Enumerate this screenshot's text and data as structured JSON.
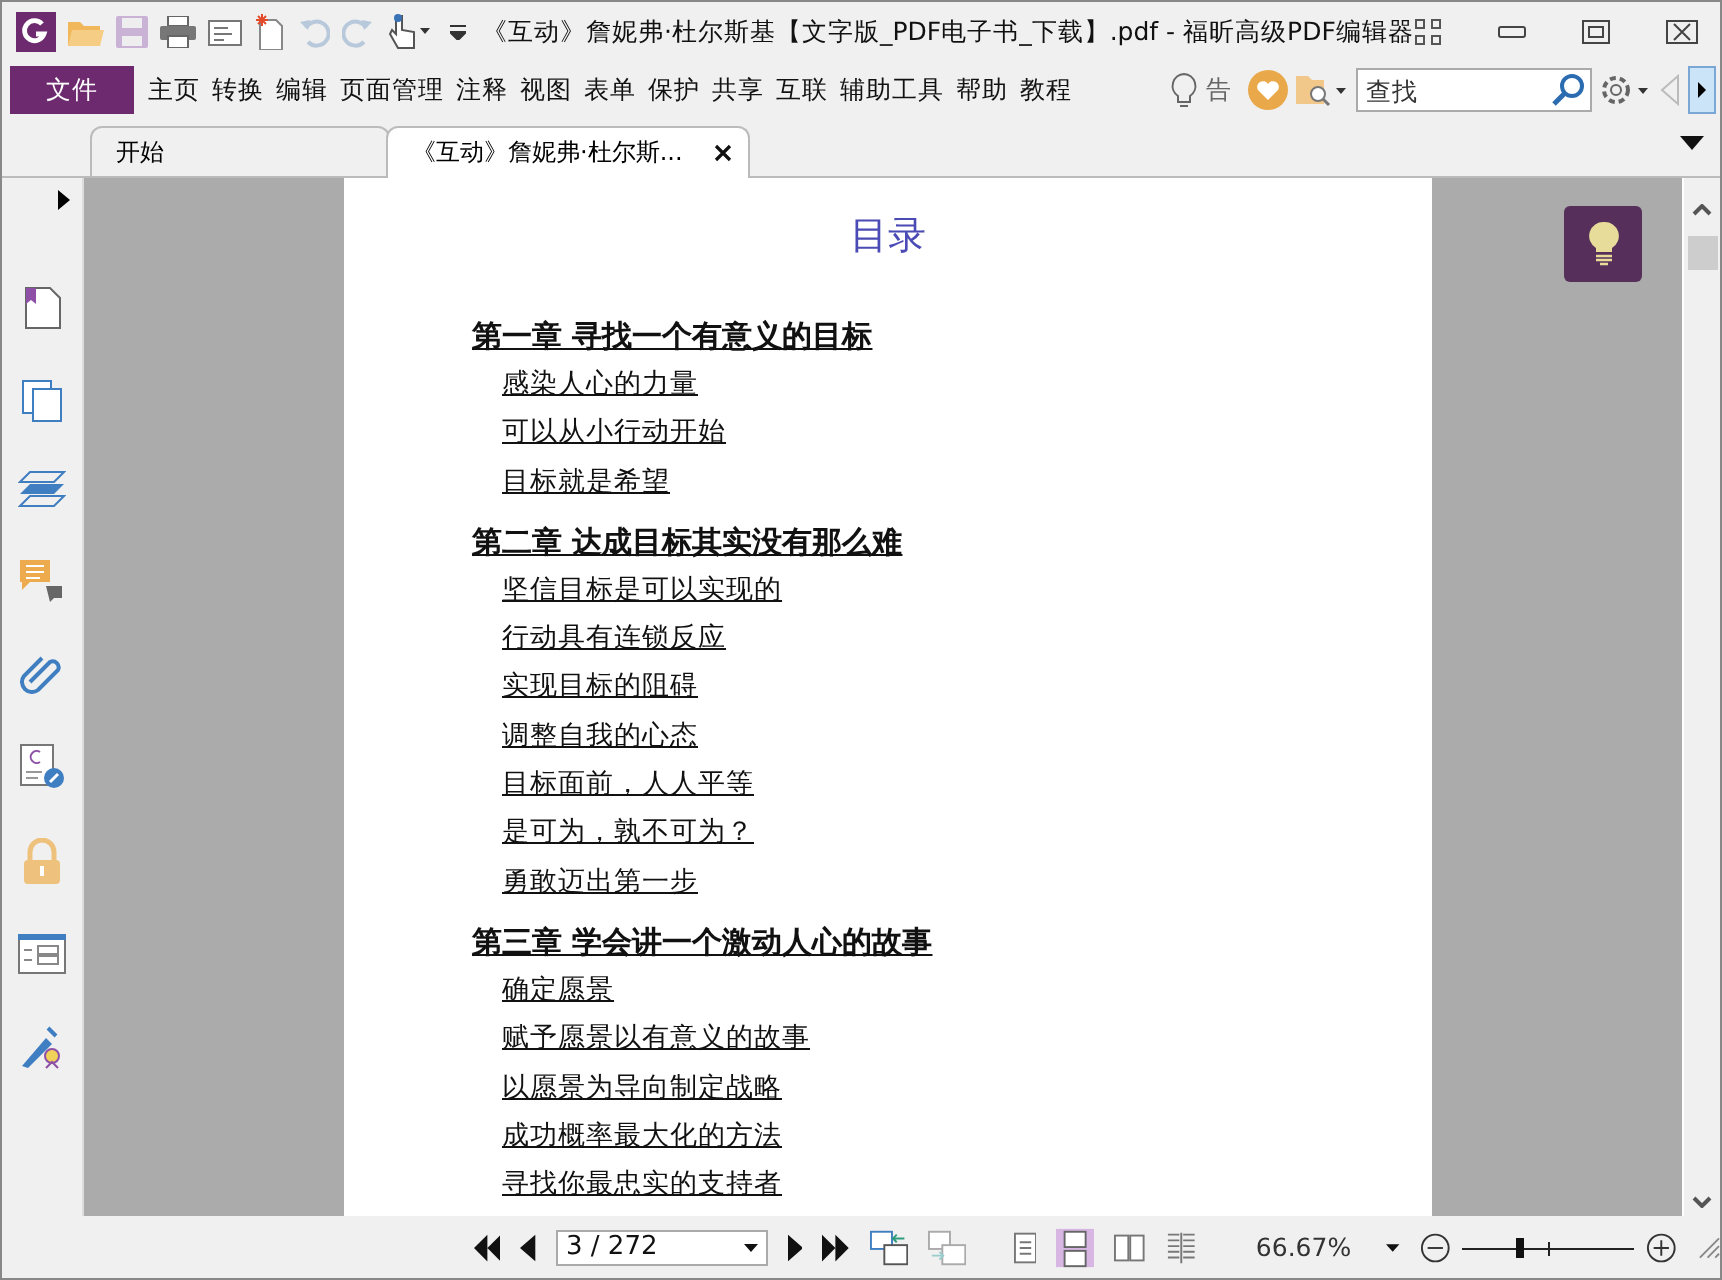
{
  "window": {
    "title": "《互动》詹妮弗·杜尔斯基【文字版_PDF电子书_下载】.pdf - 福昕高级PDF编辑器"
  },
  "menu": {
    "items": [
      {
        "label": "文件",
        "selected": true
      },
      {
        "label": "主页",
        "selected": false
      },
      {
        "label": "转换",
        "selected": false
      },
      {
        "label": "编辑",
        "selected": false
      },
      {
        "label": "页面管理",
        "selected": false
      },
      {
        "label": "注释",
        "selected": false
      },
      {
        "label": "视图",
        "selected": false
      },
      {
        "label": "表单",
        "selected": false
      },
      {
        "label": "保护",
        "selected": false
      },
      {
        "label": "共享",
        "selected": false
      },
      {
        "label": "互联",
        "selected": false
      },
      {
        "label": "辅助工具",
        "selected": false
      },
      {
        "label": "帮助",
        "selected": false
      },
      {
        "label": "教程",
        "selected": false
      }
    ],
    "tell_me": "告",
    "search": {
      "placeholder": "查找"
    }
  },
  "tabs": [
    {
      "label": "开始",
      "selected": false
    },
    {
      "label": "《互动》詹妮弗·杜尔斯...",
      "selected": true
    }
  ],
  "document": {
    "heading": "目录",
    "chapters": [
      {
        "title": "第一章 寻找一个有意义的目标",
        "items": [
          "感染人心的力量",
          "可以从小行动开始",
          "目标就是希望"
        ]
      },
      {
        "title": "第二章 达成目标其实没有那么难",
        "items": [
          "坚信目标是可以实现的",
          "行动具有连锁反应",
          "实现目标的阻碍",
          "调整自我的心态",
          "目标面前，人人平等",
          "是可为，孰不可为？",
          "勇敢迈出第一步"
        ]
      },
      {
        "title": "第三章 学会讲一个激动人心的故事",
        "items": [
          "确定愿景",
          "赋予愿景以有意义的故事",
          "以愿景为导向制定战略",
          "成功概率最大化的方法",
          "寻找你最忠实的支持者"
        ]
      }
    ]
  },
  "status_bar": {
    "page": "3 / 272",
    "zoom": "66.67%",
    "level": 0.33
  }
}
